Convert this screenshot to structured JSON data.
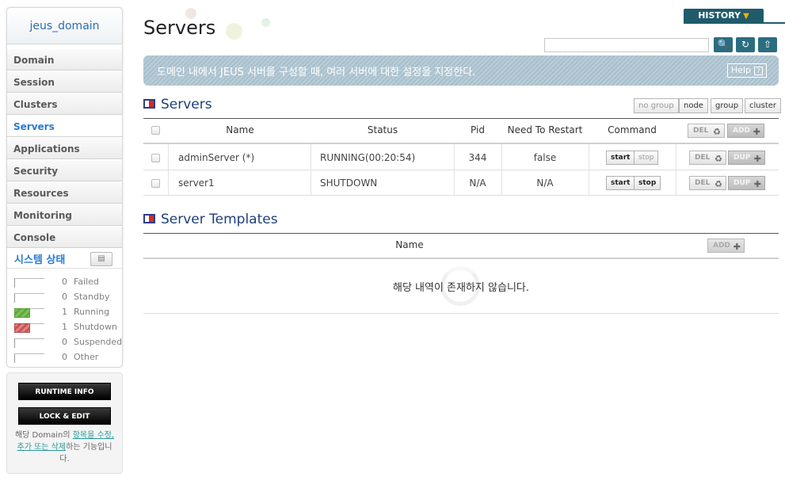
{
  "sidebar": {
    "domain": "jeus_domain",
    "items": [
      {
        "label": "Domain",
        "active": false
      },
      {
        "label": "Session",
        "active": false
      },
      {
        "label": "Clusters",
        "active": false
      },
      {
        "label": "Servers",
        "active": true
      },
      {
        "label": "Applications",
        "active": false
      },
      {
        "label": "Security",
        "active": false
      },
      {
        "label": "Resources",
        "active": false
      },
      {
        "label": "Monitoring",
        "active": false
      },
      {
        "label": "Console",
        "active": false
      }
    ],
    "system_status": {
      "title": "시스템 상태",
      "rows": [
        {
          "count": "0",
          "label": "Failed",
          "state": "none"
        },
        {
          "count": "0",
          "label": "Standby",
          "state": "none"
        },
        {
          "count": "1",
          "label": "Running",
          "state": "running"
        },
        {
          "count": "1",
          "label": "Shutdown",
          "state": "shutdown"
        },
        {
          "count": "0",
          "label": "Suspended",
          "state": "none"
        },
        {
          "count": "0",
          "label": "Other",
          "state": "none"
        }
      ]
    },
    "runtime_info": "RUNTIME INFO",
    "lock_edit": "LOCK & EDIT",
    "help_text_prefix": "해당 Domain의 ",
    "help_text_link": "항목을 수정, 추가 또는 삭제",
    "help_text_suffix": "하는 기능입니다."
  },
  "header": {
    "title": "Servers",
    "history": "HISTORY",
    "search_placeholder": ""
  },
  "banner": {
    "text": "도메인 내에서 JEUS 서버를 구성할 때, 여러 서버에 대한 설정을 지정한다.",
    "help": "Help"
  },
  "servers_section": {
    "title": "Servers",
    "filters": [
      "no group",
      "node",
      "group",
      "cluster"
    ],
    "columns": {
      "name": "Name",
      "status": "Status",
      "pid": "Pid",
      "restart": "Need To Restart",
      "command": "Command"
    },
    "header_del": "DEL",
    "header_add": "ADD",
    "rows": [
      {
        "name": "adminServer (*)",
        "status": "RUNNING(00:20:54)",
        "pid": "344",
        "restart": "false",
        "start": "start",
        "stop": "stop",
        "del": "DEL",
        "dup": "DUP"
      },
      {
        "name": "server1",
        "status": "SHUTDOWN",
        "pid": "N/A",
        "restart": "N/A",
        "start": "start",
        "stop": "stop",
        "del": "DEL",
        "dup": "DUP"
      }
    ]
  },
  "templates_section": {
    "title": "Server Templates",
    "column_name": "Name",
    "add": "ADD",
    "empty": "해당 내역이 존재하지 않습니다."
  },
  "colors": {
    "accent": "#2a7ad0",
    "section_title": "#1d3f7a",
    "history_bg": "#1f5b6b",
    "banner": "#b1c6d2",
    "running": "#6ab84a",
    "shutdown": "#d06666"
  }
}
